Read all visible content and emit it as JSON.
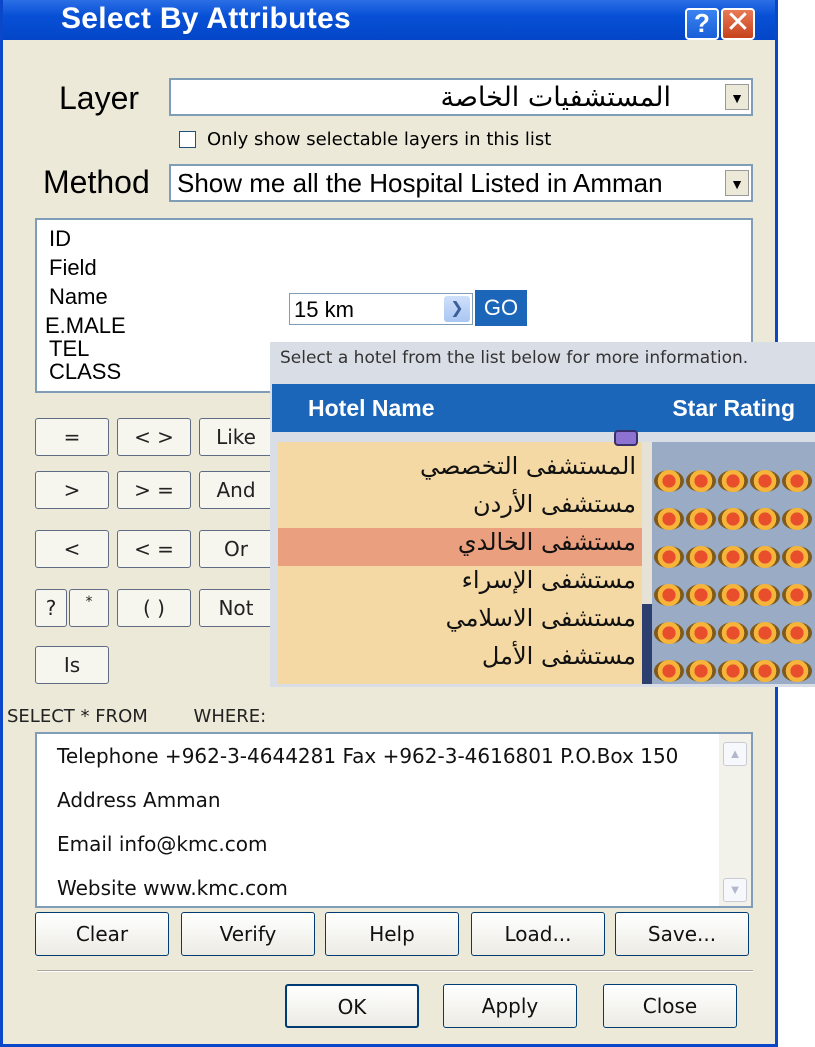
{
  "window": {
    "title": "Select By Attributes",
    "help_icon": "?",
    "close_icon": "✕"
  },
  "layer": {
    "label": "Layer",
    "value": "المستشفيات الخاصة",
    "only_selectable_label": "Only show selectable layers in this list",
    "only_selectable_checked": false
  },
  "method": {
    "label": "Method",
    "value": "Show me all the Hospital Listed in Amman"
  },
  "fields": [
    "ID",
    "Field",
    "Name",
    "E.MALE",
    "TEL",
    "CLASS"
  ],
  "distance": {
    "value": "15 km",
    "go_label": "GO"
  },
  "operators": {
    "eq": "=",
    "ne": "< >",
    "like": "Like",
    "gt": ">",
    "ge": "> =",
    "and": "And",
    "lt": "<",
    "le": "< =",
    "or": "Or",
    "q": "?",
    "star": "*",
    "paren": "( )",
    "not": "Not",
    "is": "Is"
  },
  "hotel_panel": {
    "caption": "Select a hotel from the list below for more information.",
    "col_name": "Hotel Name",
    "col_rating": "Star Rating",
    "items": [
      {
        "name": "المستشفى التخصصي",
        "stars": 5
      },
      {
        "name": "مستشفى الأردن",
        "stars": 5
      },
      {
        "name": "مستشفى الخالدي",
        "stars": 5,
        "selected": true
      },
      {
        "name": "مستشفى الإسراء",
        "stars": 5
      },
      {
        "name": "مستشفى الاسلامي",
        "stars": 5
      },
      {
        "name": "مستشفى الأمل",
        "stars": 5
      }
    ]
  },
  "sql": {
    "select_from": "SELECT * FROM",
    "where": "WHERE:"
  },
  "details": {
    "line1": "Telephone +962-3-4644281  Fax +962-3-4616801     P.O.Box 150",
    "line2": "Address  Amman",
    "line3": "Email  info@kmc.com",
    "line4": "Website  www.kmc.com"
  },
  "buttons": {
    "clear": "Clear",
    "verify": "Verify",
    "help": "Help",
    "load": "Load...",
    "save": "Save...",
    "ok": "OK",
    "apply": "Apply",
    "close": "Close"
  }
}
